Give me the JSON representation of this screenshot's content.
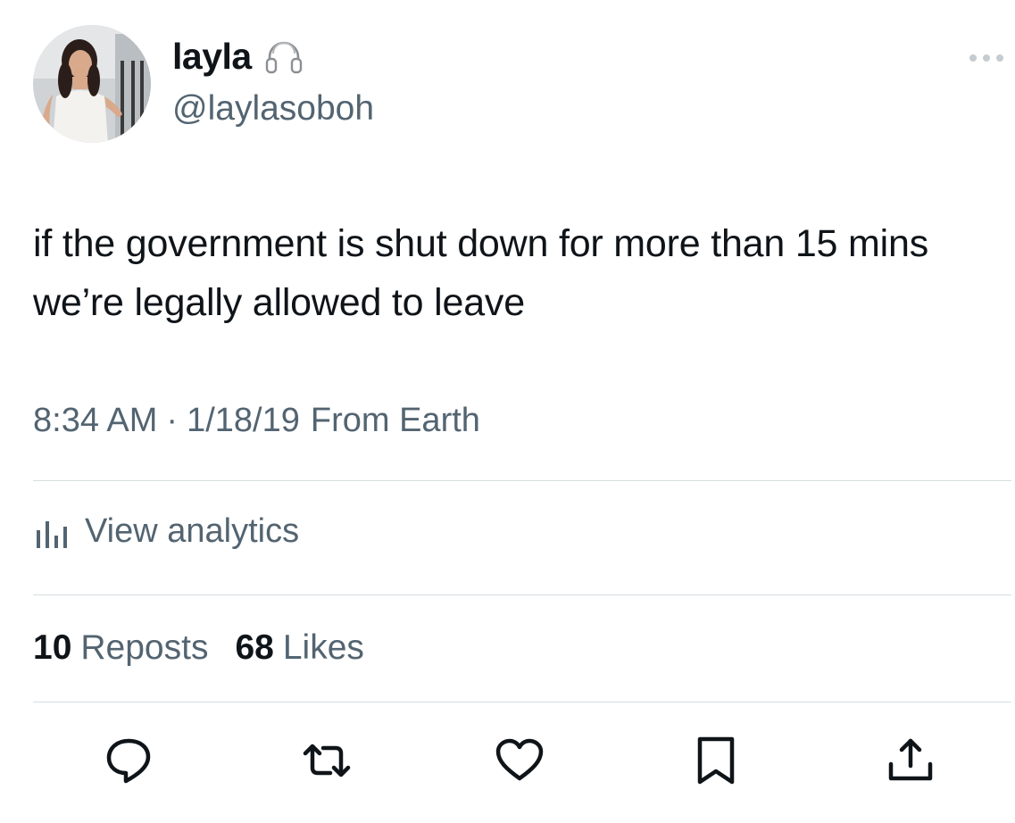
{
  "author": {
    "display_name": "layla",
    "handle": "@laylasoboh",
    "avatar_icon": "profile-photo",
    "badge_icon": "headphones-icon"
  },
  "tweet": {
    "text": "if the government is shut down for more than 15 mins we’re legally allowed to leave",
    "time": "8:34 AM",
    "date": "1/18/19",
    "source": "From Earth",
    "separator": "·"
  },
  "analytics": {
    "label": "View analytics",
    "icon": "bar-chart-icon"
  },
  "stats": {
    "reposts_count": "10",
    "reposts_label": "Reposts",
    "likes_count": "68",
    "likes_label": "Likes"
  },
  "actions": [
    {
      "name": "reply",
      "icon": "reply-icon"
    },
    {
      "name": "repost",
      "icon": "repost-icon"
    },
    {
      "name": "like",
      "icon": "heart-icon"
    },
    {
      "name": "bookmark",
      "icon": "bookmark-icon"
    },
    {
      "name": "share",
      "icon": "share-icon"
    }
  ],
  "colors": {
    "primary_text": "#0f1419",
    "secondary_text": "#536471",
    "divider": "#d7dde1",
    "background": "#ffffff"
  }
}
